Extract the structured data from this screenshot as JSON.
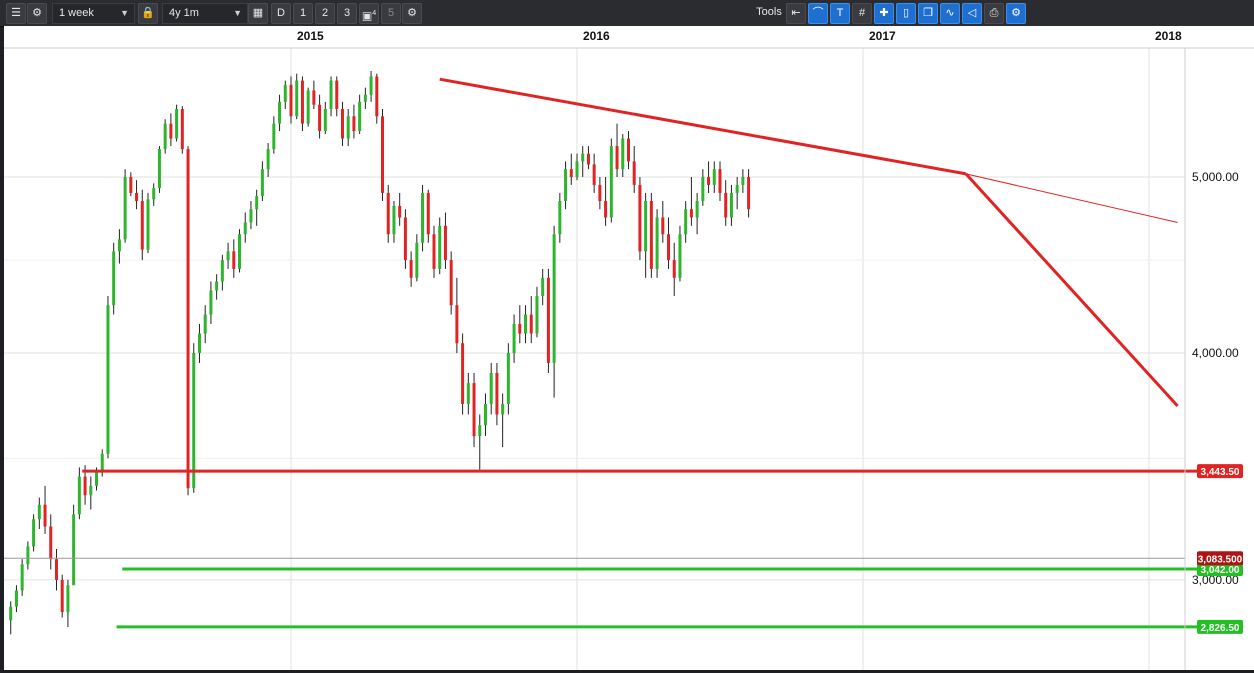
{
  "toolbar": {
    "interval": "1 week",
    "range": "4y 1m",
    "period_day": "D",
    "period_1": "1",
    "period_2": "2",
    "period_3": "3",
    "period_4": "4",
    "period_5": "5",
    "tools_label": "Tools"
  },
  "colors": {
    "up": "#2db52d",
    "down": "#e02424",
    "trend": "#e02424",
    "support": "#22c022",
    "last_price_tag": "#b01313"
  },
  "chart_data": {
    "type": "candlestick",
    "frequency": "weekly",
    "x_axis": {
      "ticks": [
        "2015",
        "2016",
        "2017",
        "2018"
      ]
    },
    "y_axis": {
      "scale": "log",
      "ticks": [
        "5,000.00",
        "4,000.00",
        "3,000.00"
      ],
      "tick_values": [
        5000,
        4000,
        3000
      ],
      "range": [
        2720,
        5720
      ]
    },
    "grid": true,
    "last_price": {
      "label": "3,083.500",
      "value": 3083.5
    },
    "horizontal_levels": [
      {
        "label": "3,443.50",
        "value": 3443.5,
        "color": "red",
        "start": 2014.27
      },
      {
        "label": "3,042.00",
        "value": 3042.0,
        "color": "green",
        "start": 2014.41
      },
      {
        "label": "2,826.50",
        "value": 2826.5,
        "color": "green",
        "start": 2014.39
      }
    ],
    "trendlines": [
      {
        "from": [
          2015.52,
          5660
        ],
        "to": [
          2017.36,
          5020
        ],
        "extended_to": [
          2018.1,
          4720
        ]
      },
      {
        "from": [
          2017.36,
          5020
        ],
        "to": [
          2018.1,
          3740
        ]
      }
    ],
    "candles": [
      [
        2014.02,
        2850,
        2920,
        2800,
        2900
      ],
      [
        2014.04,
        2900,
        2980,
        2880,
        2960
      ],
      [
        2014.06,
        2960,
        3080,
        2940,
        3060
      ],
      [
        2014.08,
        3060,
        3150,
        3040,
        3130
      ],
      [
        2014.1,
        3130,
        3260,
        3110,
        3240
      ],
      [
        2014.12,
        3240,
        3330,
        3200,
        3300
      ],
      [
        2014.14,
        3300,
        3380,
        3180,
        3210
      ],
      [
        2014.16,
        3210,
        3260,
        3040,
        3080
      ],
      [
        2014.18,
        3080,
        3120,
        2960,
        3000
      ],
      [
        2014.2,
        3000,
        3020,
        2860,
        2880
      ],
      [
        2014.22,
        2880,
        3000,
        2826,
        2980
      ],
      [
        2014.24,
        2980,
        3300,
        2980,
        3260
      ],
      [
        2014.26,
        3260,
        3460,
        3240,
        3420
      ],
      [
        2014.28,
        3420,
        3470,
        3300,
        3340
      ],
      [
        2014.3,
        3340,
        3420,
        3280,
        3380
      ],
      [
        2014.32,
        3380,
        3460,
        3360,
        3440
      ],
      [
        2014.34,
        3440,
        3540,
        3420,
        3520
      ],
      [
        2014.36,
        3520,
        4300,
        3500,
        4250
      ],
      [
        2014.38,
        4250,
        4600,
        4200,
        4550
      ],
      [
        2014.4,
        4550,
        4680,
        4480,
        4620
      ],
      [
        2014.42,
        4620,
        5050,
        4600,
        5000
      ],
      [
        2014.44,
        5000,
        5030,
        4880,
        4900
      ],
      [
        2014.46,
        4900,
        4980,
        4800,
        4850
      ],
      [
        2014.48,
        4850,
        4920,
        4500,
        4560
      ],
      [
        2014.5,
        4560,
        4900,
        4540,
        4860
      ],
      [
        2014.52,
        4860,
        4960,
        4820,
        4930
      ],
      [
        2014.54,
        4930,
        5200,
        4900,
        5180
      ],
      [
        2014.56,
        5180,
        5380,
        5150,
        5350
      ],
      [
        2014.58,
        5350,
        5420,
        5200,
        5250
      ],
      [
        2014.6,
        5250,
        5480,
        5230,
        5450
      ],
      [
        2014.62,
        5450,
        5470,
        5150,
        5180
      ],
      [
        2014.64,
        5180,
        5200,
        3340,
        3370
      ],
      [
        2014.66,
        3370,
        4050,
        3350,
        4000
      ],
      [
        2014.68,
        4000,
        4150,
        3950,
        4100
      ],
      [
        2014.7,
        4100,
        4250,
        4050,
        4200
      ],
      [
        2014.72,
        4200,
        4380,
        4150,
        4330
      ],
      [
        2014.74,
        4330,
        4420,
        4280,
        4380
      ],
      [
        2014.76,
        4380,
        4530,
        4330,
        4500
      ],
      [
        2014.78,
        4500,
        4600,
        4450,
        4550
      ],
      [
        2014.8,
        4550,
        4620,
        4400,
        4450
      ],
      [
        2014.82,
        4450,
        4680,
        4430,
        4650
      ],
      [
        2014.84,
        4650,
        4780,
        4600,
        4720
      ],
      [
        2014.86,
        4720,
        4850,
        4680,
        4800
      ],
      [
        2014.88,
        4800,
        4920,
        4700,
        4880
      ],
      [
        2014.9,
        4880,
        5100,
        4850,
        5050
      ],
      [
        2014.92,
        5050,
        5220,
        5000,
        5180
      ],
      [
        2014.94,
        5180,
        5400,
        5150,
        5350
      ],
      [
        2014.96,
        5350,
        5550,
        5300,
        5500
      ],
      [
        2014.98,
        5500,
        5650,
        5450,
        5620
      ],
      [
        2015.0,
        5620,
        5680,
        5350,
        5400
      ],
      [
        2015.02,
        5400,
        5700,
        5380,
        5650
      ],
      [
        2015.04,
        5650,
        5680,
        5300,
        5350
      ],
      [
        2015.06,
        5350,
        5600,
        5330,
        5580
      ],
      [
        2015.08,
        5580,
        5650,
        5450,
        5480
      ],
      [
        2015.1,
        5480,
        5550,
        5250,
        5300
      ],
      [
        2015.12,
        5300,
        5500,
        5280,
        5450
      ],
      [
        2015.14,
        5450,
        5680,
        5400,
        5650
      ],
      [
        2015.16,
        5650,
        5680,
        5400,
        5450
      ],
      [
        2015.18,
        5450,
        5500,
        5200,
        5250
      ],
      [
        2015.2,
        5250,
        5450,
        5200,
        5400
      ],
      [
        2015.22,
        5400,
        5480,
        5250,
        5300
      ],
      [
        2015.24,
        5300,
        5550,
        5280,
        5500
      ],
      [
        2015.26,
        5500,
        5600,
        5450,
        5550
      ],
      [
        2015.28,
        5550,
        5720,
        5500,
        5680
      ],
      [
        2015.3,
        5680,
        5700,
        5350,
        5400
      ],
      [
        2015.32,
        5400,
        5450,
        4850,
        4900
      ],
      [
        2015.34,
        4900,
        4950,
        4600,
        4650
      ],
      [
        2015.36,
        4650,
        4850,
        4600,
        4820
      ],
      [
        2015.38,
        4820,
        4900,
        4700,
        4750
      ],
      [
        2015.4,
        4750,
        4800,
        4450,
        4500
      ],
      [
        2015.42,
        4500,
        4550,
        4350,
        4400
      ],
      [
        2015.44,
        4400,
        4650,
        4380,
        4600
      ],
      [
        2015.46,
        4600,
        4950,
        4550,
        4900
      ],
      [
        2015.48,
        4900,
        4920,
        4600,
        4650
      ],
      [
        2015.5,
        4650,
        4700,
        4400,
        4450
      ],
      [
        2015.52,
        4450,
        4750,
        4420,
        4700
      ],
      [
        2015.54,
        4700,
        4780,
        4450,
        4500
      ],
      [
        2015.56,
        4500,
        4550,
        4200,
        4250
      ],
      [
        2015.58,
        4250,
        4400,
        4000,
        4050
      ],
      [
        2015.6,
        4050,
        4100,
        3700,
        3750
      ],
      [
        2015.62,
        3750,
        3900,
        3700,
        3850
      ],
      [
        2015.64,
        3850,
        3900,
        3550,
        3600
      ],
      [
        2015.66,
        3600,
        3700,
        3450,
        3650
      ],
      [
        2015.68,
        3650,
        3800,
        3600,
        3750
      ],
      [
        2015.7,
        3750,
        3950,
        3700,
        3900
      ],
      [
        2015.72,
        3900,
        3950,
        3650,
        3700
      ],
      [
        2015.74,
        3700,
        3800,
        3550,
        3750
      ],
      [
        2015.76,
        3750,
        4050,
        3700,
        4000
      ],
      [
        2015.78,
        4000,
        4200,
        3950,
        4150
      ],
      [
        2015.8,
        4150,
        4250,
        4050,
        4100
      ],
      [
        2015.82,
        4100,
        4250,
        4050,
        4200
      ],
      [
        2015.84,
        4200,
        4300,
        4050,
        4100
      ],
      [
        2015.86,
        4100,
        4350,
        4080,
        4300
      ],
      [
        2015.88,
        4300,
        4450,
        4250,
        4400
      ],
      [
        2015.9,
        4400,
        4450,
        3900,
        3950
      ],
      [
        2015.92,
        3950,
        4700,
        3780,
        4650
      ],
      [
        2015.94,
        4650,
        4900,
        4600,
        4850
      ],
      [
        2015.96,
        4850,
        5100,
        4800,
        5050
      ],
      [
        2015.98,
        5050,
        5150,
        4950,
        5000
      ],
      [
        2016.0,
        5000,
        5150,
        4980,
        5100
      ],
      [
        2016.02,
        5100,
        5200,
        5000,
        5150
      ],
      [
        2016.04,
        5150,
        5200,
        5050,
        5080
      ],
      [
        2016.06,
        5080,
        5150,
        4900,
        4950
      ],
      [
        2016.08,
        4950,
        5000,
        4800,
        4850
      ],
      [
        2016.1,
        4850,
        5000,
        4700,
        4750
      ],
      [
        2016.12,
        4750,
        5250,
        4720,
        5200
      ],
      [
        2016.14,
        5200,
        5350,
        5000,
        5050
      ],
      [
        2016.16,
        5050,
        5280,
        5000,
        5250
      ],
      [
        2016.18,
        5250,
        5300,
        5050,
        5100
      ],
      [
        2016.2,
        5100,
        5200,
        4900,
        4950
      ],
      [
        2016.22,
        4950,
        5000,
        4500,
        4550
      ],
      [
        2016.24,
        4550,
        4900,
        4400,
        4850
      ],
      [
        2016.26,
        4850,
        4900,
        4400,
        4450
      ],
      [
        2016.28,
        4450,
        4800,
        4400,
        4750
      ],
      [
        2016.3,
        4750,
        4850,
        4600,
        4650
      ],
      [
        2016.32,
        4650,
        4750,
        4450,
        4500
      ],
      [
        2016.34,
        4500,
        4600,
        4300,
        4400
      ],
      [
        2016.36,
        4400,
        4700,
        4380,
        4650
      ],
      [
        2016.38,
        4650,
        4850,
        4600,
        4800
      ],
      [
        2016.4,
        4800,
        5000,
        4700,
        4750
      ],
      [
        2016.42,
        4750,
        4900,
        4650,
        4850
      ],
      [
        2016.44,
        4850,
        5050,
        4820,
        5000
      ],
      [
        2016.46,
        5000,
        5100,
        4900,
        4950
      ],
      [
        2016.48,
        4950,
        5100,
        4900,
        5050
      ],
      [
        2016.5,
        5050,
        5100,
        4850,
        4900
      ],
      [
        2016.52,
        4900,
        4980,
        4700,
        4750
      ],
      [
        2016.54,
        4750,
        4950,
        4700,
        4900
      ],
      [
        2016.56,
        4900,
        5000,
        4800,
        4950
      ],
      [
        2016.58,
        4950,
        5050,
        4900,
        5000
      ],
      [
        2016.6,
        5000,
        5050,
        4750,
        4800
      ]
    ]
  }
}
